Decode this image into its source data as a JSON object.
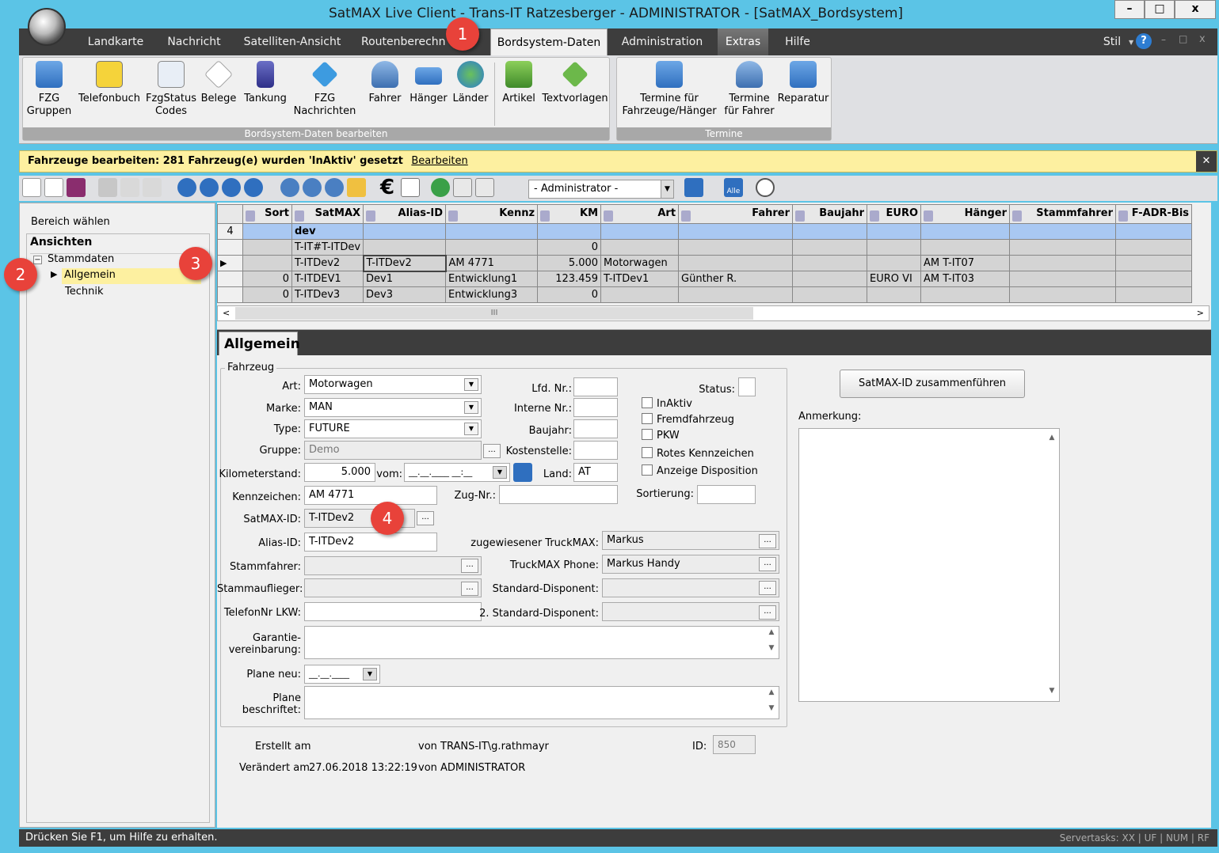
{
  "window": {
    "title": "SatMAX Live Client - Trans-IT Ratzesberger - ADMINISTRATOR - [SatMAX_Bordsystem]",
    "controls": [
      "–",
      "□",
      "x"
    ]
  },
  "menu": {
    "tabs": [
      "Landkarte",
      "Nachricht",
      "Satelliten-Ansicht",
      "Routenberechn",
      "Bordsystem-Daten",
      "Administration",
      "Extras",
      "Hilfe"
    ],
    "right": {
      "stil": "Stil",
      "help": "?",
      "min": "–",
      "restore": "□",
      "close": "x"
    }
  },
  "ribbon": {
    "group1_label": "Bordsystem-Daten bearbeiten",
    "group2_label": "Termine",
    "buttons": [
      {
        "l1": "FZG",
        "l2": "Gruppen"
      },
      {
        "l1": "Telefonbuch",
        "l2": ""
      },
      {
        "l1": "FzgStatus",
        "l2": "Codes"
      },
      {
        "l1": "Belege",
        "l2": ""
      },
      {
        "l1": "Tankung",
        "l2": ""
      },
      {
        "l1": "FZG",
        "l2": "Nachrichten"
      },
      {
        "l1": "Fahrer",
        "l2": ""
      },
      {
        "l1": "Hänger",
        "l2": ""
      },
      {
        "l1": "Länder",
        "l2": ""
      },
      {
        "l1": "Artikel",
        "l2": ""
      },
      {
        "l1": "Textvorlagen",
        "l2": ""
      },
      {
        "l1": "Termine für",
        "l2": "Fahrzeuge/Hänger"
      },
      {
        "l1": "Termine",
        "l2": "für Fahrer"
      },
      {
        "l1": "Reparatur",
        "l2": ""
      }
    ]
  },
  "notification": {
    "text": "Fahrzeuge bearbeiten: 281 Fahrzeug(e) wurden 'InAktiv' gesetzt",
    "link": "Bearbeiten",
    "close": "✕"
  },
  "toolbar": {
    "admin_select": "- Administrator -",
    "alle": "Alle"
  },
  "left": {
    "bereich": "Bereich wählen",
    "ansichten": "Ansichten",
    "tree": {
      "stammdaten": "Stammdaten",
      "allgemein": "Allgemein",
      "technik": "Technik",
      "expander": "−"
    }
  },
  "grid": {
    "headers": [
      "Sort",
      "SatMAX",
      "Alias-ID",
      "Kennz",
      "KM",
      "Art",
      "Fahrer",
      "Baujahr",
      "EURO",
      "Hänger",
      "Stammfahrer",
      "F-ADR-Bis"
    ],
    "group_row": {
      "count": "4",
      "label": "dev"
    },
    "rows": [
      {
        "sort": "",
        "satmax": "T-IT#T-ITDev",
        "alias": "",
        "kennz": "",
        "km": "0",
        "art": "",
        "fahrer": "",
        "baujahr": "",
        "euro": "",
        "haenger": "",
        "stammfahrer": "",
        "fadr": ""
      },
      {
        "sort": "",
        "satmax": "T-ITDev2",
        "alias": "T-ITDev2",
        "kennz": "AM 4771",
        "km": "5.000",
        "art": "Motorwagen",
        "fahrer": "",
        "baujahr": "",
        "euro": "",
        "haenger": "AM T-IT07",
        "stammfahrer": "",
        "fadr": ""
      },
      {
        "sort": "0",
        "satmax": "T-ITDEV1",
        "alias": "Dev1",
        "kennz": "Entwicklung1",
        "km": "123.459",
        "art": "T-ITDev1",
        "fahrer": "Günther R.",
        "baujahr": "",
        "euro": "EURO VI",
        "haenger": "AM T-IT03",
        "stammfahrer": "",
        "fadr": ""
      },
      {
        "sort": "0",
        "satmax": "T-ITDev3",
        "alias": "Dev3",
        "kennz": "Entwicklung3",
        "km": "0",
        "art": "",
        "fahrer": "",
        "baujahr": "",
        "euro": "",
        "haenger": "",
        "stammfahrer": "",
        "fadr": ""
      }
    ],
    "scroll_grip": "III"
  },
  "detail": {
    "tab": "Allgemein",
    "fieldset": "Fahrzeug",
    "labels": {
      "art": "Art:",
      "marke": "Marke:",
      "type": "Type:",
      "gruppe": "Gruppe:",
      "km": "Kilometerstand:",
      "vom": "vom:",
      "kennzeichen": "Kennzeichen:",
      "satmaxid": "SatMAX-ID:",
      "aliasid": "Alias-ID:",
      "stammfahrer": "Stammfahrer:",
      "stammauflieger": "Stammauflieger:",
      "telefon": "TelefonNr LKW:",
      "garantie1": "Garantie-",
      "garantie2": "vereinbarung:",
      "planeneu": "Plane neu:",
      "plane1": "Plane",
      "plane2": "beschriftet:",
      "lfd": "Lfd. Nr.:",
      "interne": "Interne Nr.:",
      "baujahr": "Baujahr:",
      "kostenstelle": "Kostenstelle:",
      "land": "Land:",
      "zugnr": "Zug-Nr.:",
      "truckmax": "zugewiesener TruckMAX:",
      "truckphone": "TruckMAX Phone:",
      "disponent": "Standard-Disponent:",
      "disponent2": "2. Standard-Disponent:",
      "status": "Status:",
      "sortierung": "Sortierung:",
      "anmerkung": "Anmerkung:"
    },
    "values": {
      "art": "Motorwagen",
      "marke": "MAN",
      "type": "FUTURE",
      "gruppe": "Demo",
      "km": "5.000",
      "vom": "__.__.____ __:__",
      "kennzeichen": "AM 4771",
      "satmaxid": "T-ITDev2",
      "aliasid": "T-ITDev2",
      "stammfahrer": "",
      "stammauflieger": "",
      "telefon": "",
      "planeneu": "__.__.____",
      "land": "AT",
      "truckmax": "Markus",
      "truckphone": "Markus Handy",
      "lfd": "",
      "interne": "",
      "baujahr": "",
      "kostenstelle": "",
      "zugnr": "",
      "status": "",
      "sortierung": "",
      "disponent": "",
      "disponent2": "",
      "garantie": "",
      "plane": "",
      "anmerkung": ""
    },
    "checkboxes": [
      "InAktiv",
      "Fremdfahrzeug",
      "PKW",
      "Rotes Kennzeichen",
      "Anzeige Disposition"
    ],
    "merge_button": "SatMAX-ID zusammenführen",
    "ellipsis": "...",
    "footer": {
      "erstellt": "Erstellt am",
      "erstellt_von": "von TRANS-IT\\g.rathmayr",
      "geaendert": "Verändert am",
      "geaendert_datum": "27.06.2018 13:22:19",
      "geaendert_von": "von ADMINISTRATOR",
      "id_label": "ID:",
      "id_value": "850"
    }
  },
  "statusbar": {
    "text": "Drücken Sie F1, um Hilfe zu erhalten.",
    "right": "Servertasks: XX | UF | NUM | RF"
  },
  "callouts": [
    "1",
    "2",
    "3",
    "4"
  ],
  "colors": {
    "accent": "#5bc4e6",
    "dark": "#3d3d3d",
    "notify": "#fdf0a0",
    "selection": "#a9c8f2",
    "callout": "#e8423a"
  }
}
